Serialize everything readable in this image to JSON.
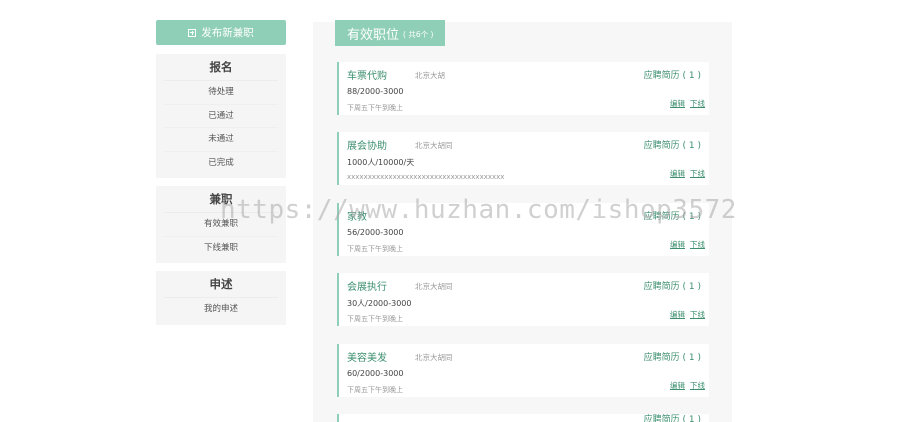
{
  "sidebar": {
    "publish_label": "发布新兼职",
    "groups": [
      {
        "title": "报名",
        "items": [
          "待处理",
          "已通过",
          "未通过",
          "已完成"
        ]
      },
      {
        "title": "兼职",
        "items": [
          "有效兼职",
          "下线兼职"
        ]
      },
      {
        "title": "申述",
        "items": [
          "我的申述"
        ]
      }
    ]
  },
  "main": {
    "tab_title": "有效职位",
    "tab_count": "( 共6个 )",
    "edit_label": "编辑",
    "offline_label": "下线",
    "jobs": [
      {
        "title": "车票代购",
        "location": "北京大胡",
        "detail": "88/2000-3000",
        "desc": "下周五下午到晚上",
        "apps": "应聘简历 ( 1 )"
      },
      {
        "title": "展会协助",
        "location": "北京大胡同",
        "detail": "1000人/10000/天",
        "desc": "xxxxxxxxxxxxxxxxxxxxxxxxxxxxxxxxxxxxxx",
        "apps": "应聘简历 ( 1 )"
      },
      {
        "title": "家教",
        "location": "",
        "detail": "56/2000-3000",
        "desc": "下周五下午到晚上",
        "apps": "应聘简历 ( 1 )"
      },
      {
        "title": "会展执行",
        "location": "北京大胡同",
        "detail": "30人/2000-3000",
        "desc": "下周五下午到晚上",
        "apps": "应聘简历 ( 1 )"
      },
      {
        "title": "美容美发",
        "location": "北京大胡同",
        "detail": "60/2000-3000",
        "desc": "下周五下午到晚上",
        "apps": "应聘简历 ( 1 )"
      },
      {
        "title": "",
        "location": "",
        "detail": "",
        "desc": "",
        "apps": "应聘简历 ( 1 )"
      }
    ]
  },
  "watermark": "https://www.huzhan.com/ishop3572",
  "colors": {
    "accent": "#8fcfb8",
    "link": "#3d8f70"
  }
}
